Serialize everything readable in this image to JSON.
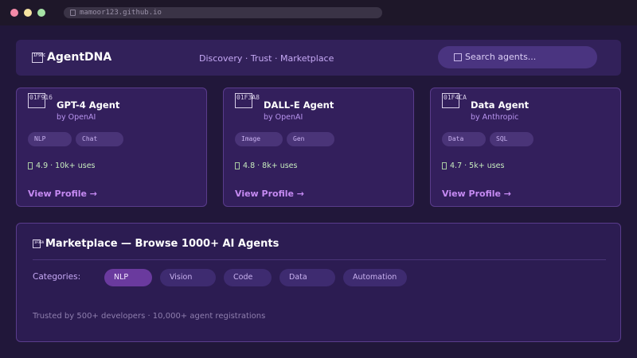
{
  "browser": {
    "url": "mamoor123.github.io"
  },
  "nav": {
    "logo_glyph": "1F9EC",
    "logo_text": "AgentDNA",
    "links": "Discovery · Trust · Marketplace",
    "search_placeholder": "Search agents..."
  },
  "agents": [
    {
      "glyph": "01F916",
      "name": "GPT-4 Agent",
      "by": "by OpenAI",
      "tags": [
        "NLP",
        "Chat"
      ],
      "stats": "4.9 · 10k+ uses",
      "link": "View Profile →"
    },
    {
      "glyph": "01F3A8",
      "name": "DALL-E Agent",
      "by": "by OpenAI",
      "tags": [
        "Image",
        "Gen"
      ],
      "stats": "4.8 · 8k+ uses",
      "link": "View Profile →"
    },
    {
      "glyph": "01F4CA",
      "name": "Data Agent",
      "by": "by Anthropic",
      "tags": [
        "Data",
        "SQL"
      ],
      "stats": "4.7 · 5k+ uses",
      "link": "View Profile →"
    }
  ],
  "marketplace": {
    "glyph": "1F3EA",
    "title": "Marketplace — Browse 1000+ AI Agents",
    "categories_label": "Categories:",
    "categories": [
      "NLP",
      "Vision",
      "Code",
      "Data",
      "Automation"
    ],
    "active_category": "NLP",
    "trust_text": "Trusted by 500+ developers · 10,000+ agent registrations"
  },
  "colors": {
    "background": "#21173a",
    "card": "#331f5c",
    "accent": "#c58af2",
    "active_chip": "#6a3a9e"
  }
}
